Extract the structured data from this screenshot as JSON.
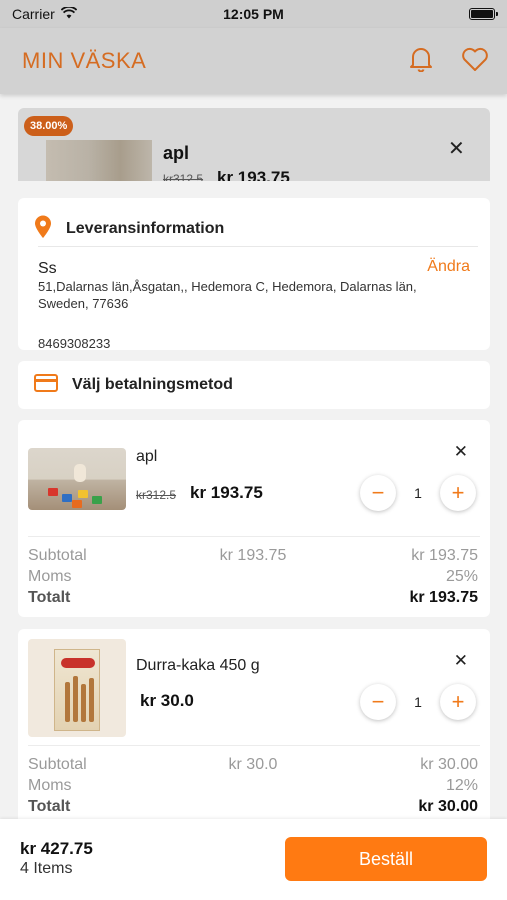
{
  "status_bar": {
    "carrier": "Carrier",
    "time": "12:05 PM"
  },
  "header": {
    "title": "MIN VÄSKA"
  },
  "background_item": {
    "discount_badge": "38.00%",
    "name": "apl",
    "old_price": "kr312.5",
    "price": "kr 193.75"
  },
  "delivery": {
    "heading": "Leveransinformation",
    "name": "Ss",
    "change_label": "Ändra",
    "address": "51,Dalarnas län,Åsgatan,, Hedemora C, Hedemora, Dalarnas län, Sweden, 77636",
    "phone": "8469308233"
  },
  "payment": {
    "heading": "Välj betalningsmetod"
  },
  "cart_items": [
    {
      "name": "apl",
      "old_price": "kr312.5",
      "price": "kr 193.75",
      "quantity": "1",
      "summary": {
        "subtotal_label": "Subtotal",
        "subtotal_mid": "kr 193.75",
        "subtotal_value": "kr 193.75",
        "moms_label": "Moms",
        "moms_value": "25%",
        "total_label": "Totalt",
        "total_value": "kr 193.75"
      }
    },
    {
      "name": "Durra-kaka 450 g",
      "price": "kr 30.0",
      "quantity": "1",
      "summary": {
        "subtotal_label": "Subtotal",
        "subtotal_mid": "kr 30.0",
        "subtotal_value": "kr 30.00",
        "moms_label": "Moms",
        "moms_value": "12%",
        "total_label": "Totalt",
        "total_value": "kr 30.00"
      }
    }
  ],
  "footer": {
    "total": "kr 427.75",
    "item_count": "4 Items",
    "order_label": "Beställ"
  },
  "colors": {
    "accent": "#f07a1a",
    "order_button": "#ff7a12",
    "badge": "#cc5f1a"
  },
  "icons": {
    "notification": "bell-icon",
    "favorites": "heart-icon",
    "location": "location-pin-icon",
    "card": "credit-card-icon",
    "remove": "close-icon"
  }
}
